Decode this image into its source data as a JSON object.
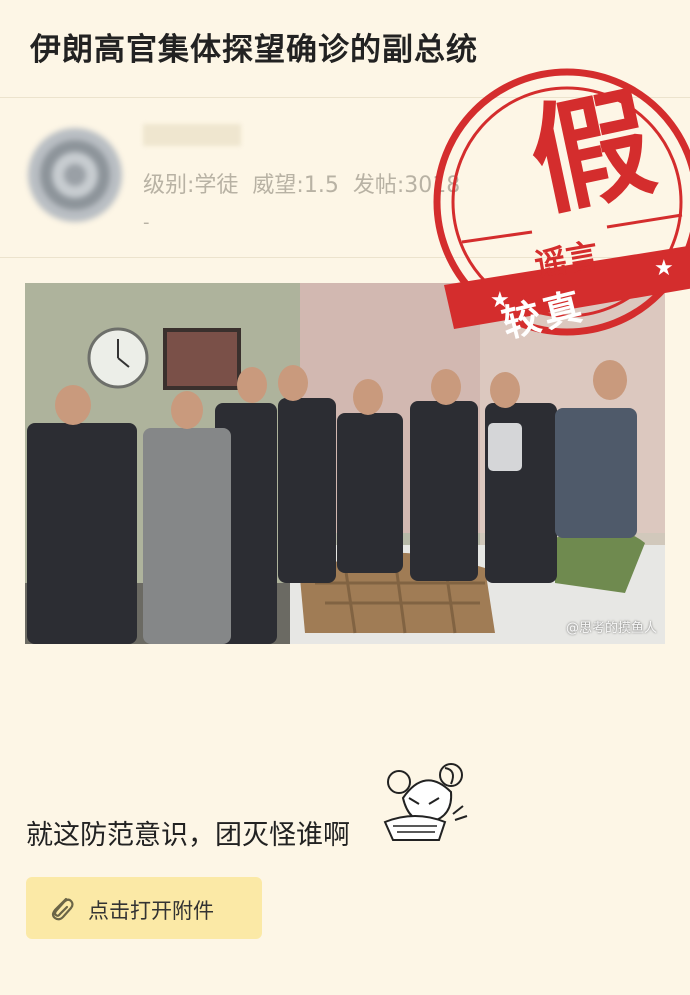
{
  "post": {
    "title": "伊朗高官集体探望确诊的副总统",
    "author": {
      "username": "",
      "level": "级别:学徒",
      "reputation": "威望:1.5",
      "posts": "发帖:3018",
      "extra": "-"
    },
    "image": {
      "watermark": "@思考的摸鱼人"
    },
    "stamp": {
      "main": "假",
      "sub": "谣言",
      "ribbon": "较真",
      "color": "#d42d2d"
    },
    "body_text": "就这防范意识，团灭怪谁啊",
    "sticker_icon": "anime-girl-sticker",
    "attachment": {
      "label": "点击打开附件",
      "icon": "paperclip-icon",
      "bg_color": "#fbe9a6"
    }
  },
  "colors": {
    "background": "#fdf6e6",
    "muted_text": "#b8b2a4"
  }
}
